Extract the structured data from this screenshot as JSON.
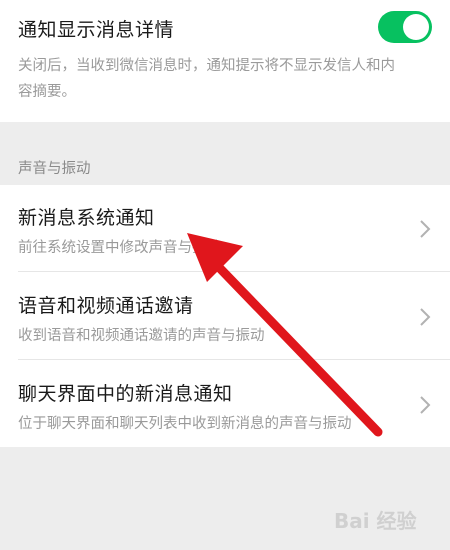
{
  "notify": {
    "title": "通知显示消息详情",
    "description_line1": "关闭后，当收到微信消息时，通知提示将不显示发信人和内",
    "description_line2": "容摘要。",
    "enabled": true
  },
  "section": {
    "header": "声音与振动"
  },
  "items": [
    {
      "title": "新消息系统通知",
      "subtitle": "前往系统设置中修改声音与振动"
    },
    {
      "title": "语音和视频通话邀请",
      "subtitle": "收到语音和视频通话邀请的声音与振动"
    },
    {
      "title": "聊天界面中的新消息通知",
      "subtitle": "位于聊天界面和聊天列表中收到新消息的声音与振动"
    }
  ],
  "icons": {
    "chevron": "chevron-right-icon"
  },
  "colors": {
    "toggle_on": "#07c160",
    "annotation_arrow": "#e0161c"
  },
  "watermark": {
    "text": "Bai 经验"
  }
}
